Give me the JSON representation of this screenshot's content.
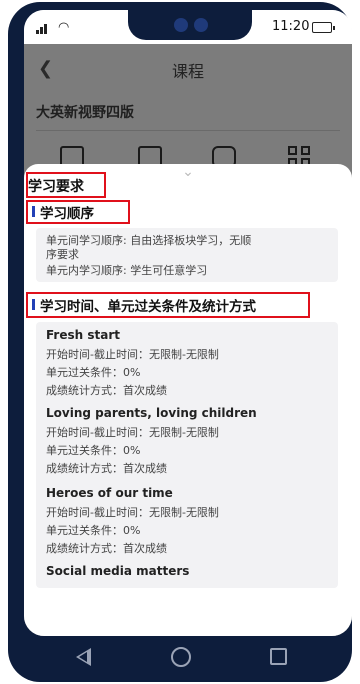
{
  "status_bar": {
    "time": "11:20"
  },
  "header": {
    "title": "课程",
    "back_icon": "chevron-left-icon"
  },
  "course": {
    "name": "大英新视野四版"
  },
  "toolbar_icons": [
    "document-play-icon",
    "calendar-check-icon",
    "print-icon",
    "grid-apps-icon"
  ],
  "sheet": {
    "handle_icon": "chevron-down-icon",
    "requirements_title": "学习要求",
    "order_section": {
      "title": "学习顺序",
      "lines": [
        "单元间学习顺序: 自由选择板块学习，无顺",
        "序要求",
        "单元内学习顺序: 学生可任意学习"
      ]
    },
    "time_section": {
      "title": "学习时间、单元过关条件及统计方式",
      "units": [
        {
          "name": "Fresh start",
          "time": "开始时间-截止时间：无限制-无限制",
          "pass": "单元过关条件：0%",
          "stat": "成绩统计方式：首次成绩"
        },
        {
          "name": "Loving parents, loving children",
          "time": "开始时间-截止时间：无限制-无限制",
          "pass": "单元过关条件：0%",
          "stat": "成绩统计方式：首次成绩"
        },
        {
          "name": "Heroes of our time",
          "time": "开始时间-截止时间：无限制-无限制",
          "pass": "单元过关条件：0%",
          "stat": "成绩统计方式：首次成绩"
        },
        {
          "name": "Social media matters"
        }
      ]
    }
  },
  "android_nav": [
    "back-triangle-icon",
    "home-circle-icon",
    "recent-square-icon"
  ],
  "colors": {
    "frame": "#0d1d3c",
    "highlight": "#e0101b",
    "section_bar": "#2240b6",
    "overlay": "#7c7c7c"
  }
}
